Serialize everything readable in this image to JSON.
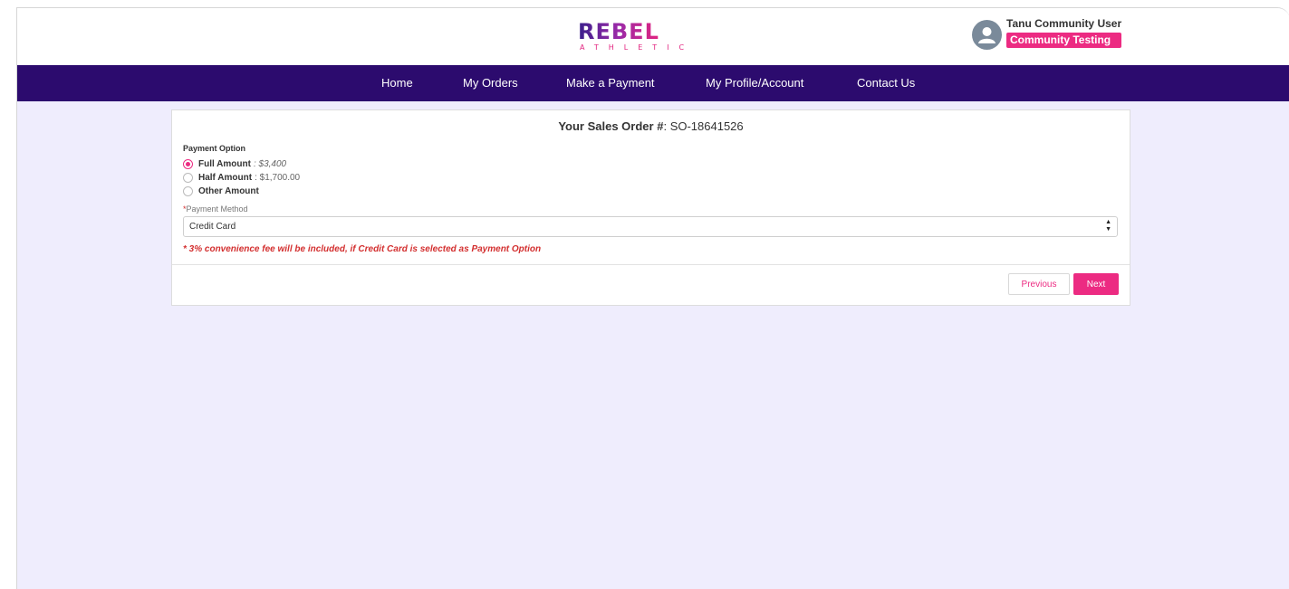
{
  "brand": {
    "logo_text": "REBEL",
    "logo_subtext": "ATHLETIC"
  },
  "user": {
    "name": "Tanu Community User",
    "role": "Community Testing",
    "avatar_icon": "user-avatar-icon"
  },
  "nav": {
    "items": [
      {
        "label": "Home"
      },
      {
        "label": "My Orders"
      },
      {
        "label": "Make a Payment"
      },
      {
        "label": "My Profile/Account"
      },
      {
        "label": "Contact Us"
      }
    ]
  },
  "order": {
    "title_label": "Your Sales Order #",
    "separator": ":",
    "number": "SO-18641526"
  },
  "payment_option": {
    "label": "Payment Option",
    "options": [
      {
        "label": "Full Amount",
        "value": ": $3,400",
        "selected": true
      },
      {
        "label": "Half Amount",
        "value": ": $1,700.00",
        "selected": false
      },
      {
        "label": "Other Amount",
        "value": "",
        "selected": false
      }
    ]
  },
  "payment_method": {
    "required_mark": "*",
    "label": "Payment Method",
    "selected": "Credit Card"
  },
  "fee_note": "* 3% convenience fee will be included, if Credit Card is selected as Payment Option",
  "buttons": {
    "previous": "Previous",
    "next": "Next"
  },
  "colors": {
    "accent": "#ec2b82",
    "nav_bg": "#2c0b6e",
    "page_bg": "#efedfd"
  }
}
